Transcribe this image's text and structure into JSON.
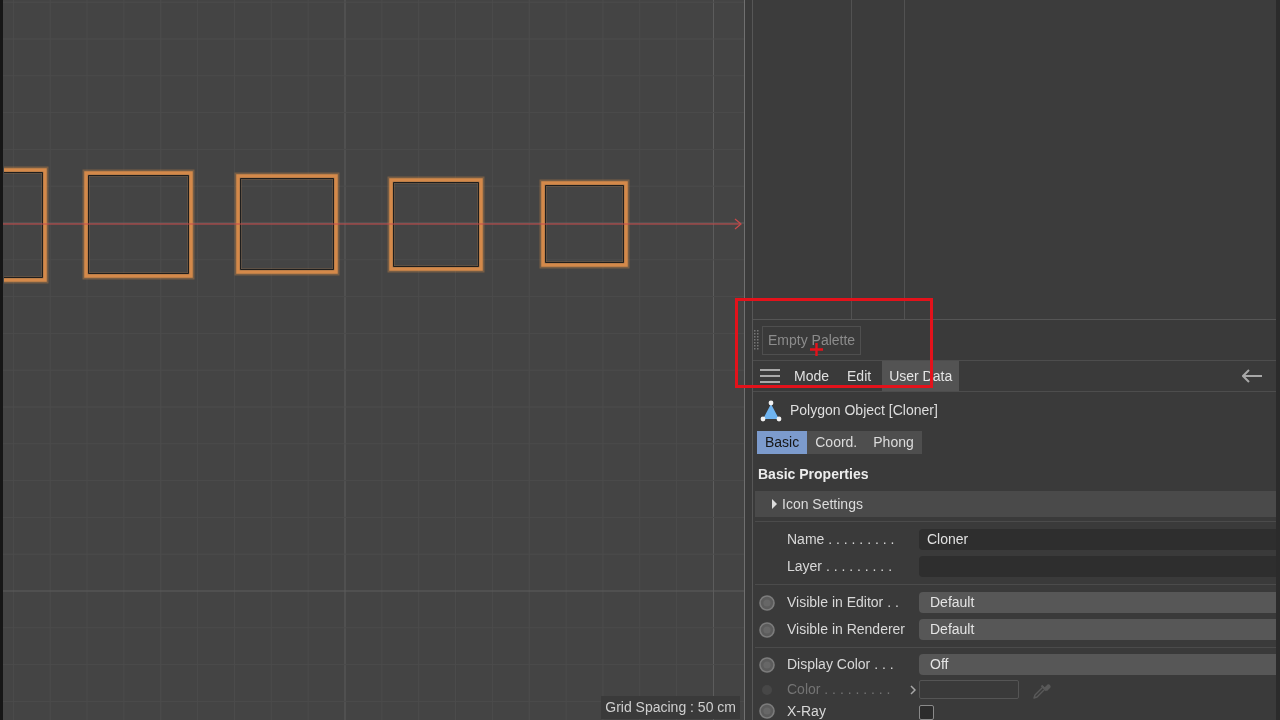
{
  "viewport": {
    "grid_spacing": "Grid Spacing : 50 cm"
  },
  "palette": {
    "label": "Empty Palette"
  },
  "attribute_manager": {
    "menu": [
      {
        "label": "Mode",
        "selected": false
      },
      {
        "label": "Edit",
        "selected": false
      },
      {
        "label": "User Data",
        "selected": true
      }
    ],
    "object_title": "Polygon Object [Cloner]",
    "tabs": [
      {
        "label": "Basic",
        "selected": true
      },
      {
        "label": "Coord.",
        "selected": false
      },
      {
        "label": "Phong",
        "selected": false
      }
    ],
    "section_title": "Basic Properties",
    "subsection": {
      "label": "Icon Settings",
      "expanded": false
    },
    "field_groups": [
      {
        "fields": [
          {
            "kind": "text",
            "label": "Name . . . . . . . . .",
            "value": "Cloner",
            "keyframe_button": false,
            "disabled": false
          },
          {
            "kind": "text",
            "label": "Layer . . . . . . . . .",
            "keyframe_button": false,
            "disabled": false
          }
        ]
      },
      {
        "fields": [
          {
            "kind": "dropdown",
            "label": "Visible in Editor . .",
            "value": "Default",
            "keyframe_button": true,
            "disabled": false
          },
          {
            "kind": "dropdown",
            "label": "Visible in Renderer",
            "value": "Default",
            "keyframe_button": true,
            "disabled": false
          }
        ]
      },
      {
        "fields": [
          {
            "kind": "dropdown",
            "label": "Display Color . . .",
            "value": "Off",
            "keyframe_button": true,
            "disabled": false
          },
          {
            "kind": "color",
            "label": "Color . . . . . . . . .",
            "keyframe_button": true,
            "disabled": true
          },
          {
            "kind": "checkbox",
            "label": "X-Ray",
            "checked": false,
            "keyframe_button": true,
            "disabled": false
          }
        ]
      }
    ]
  }
}
